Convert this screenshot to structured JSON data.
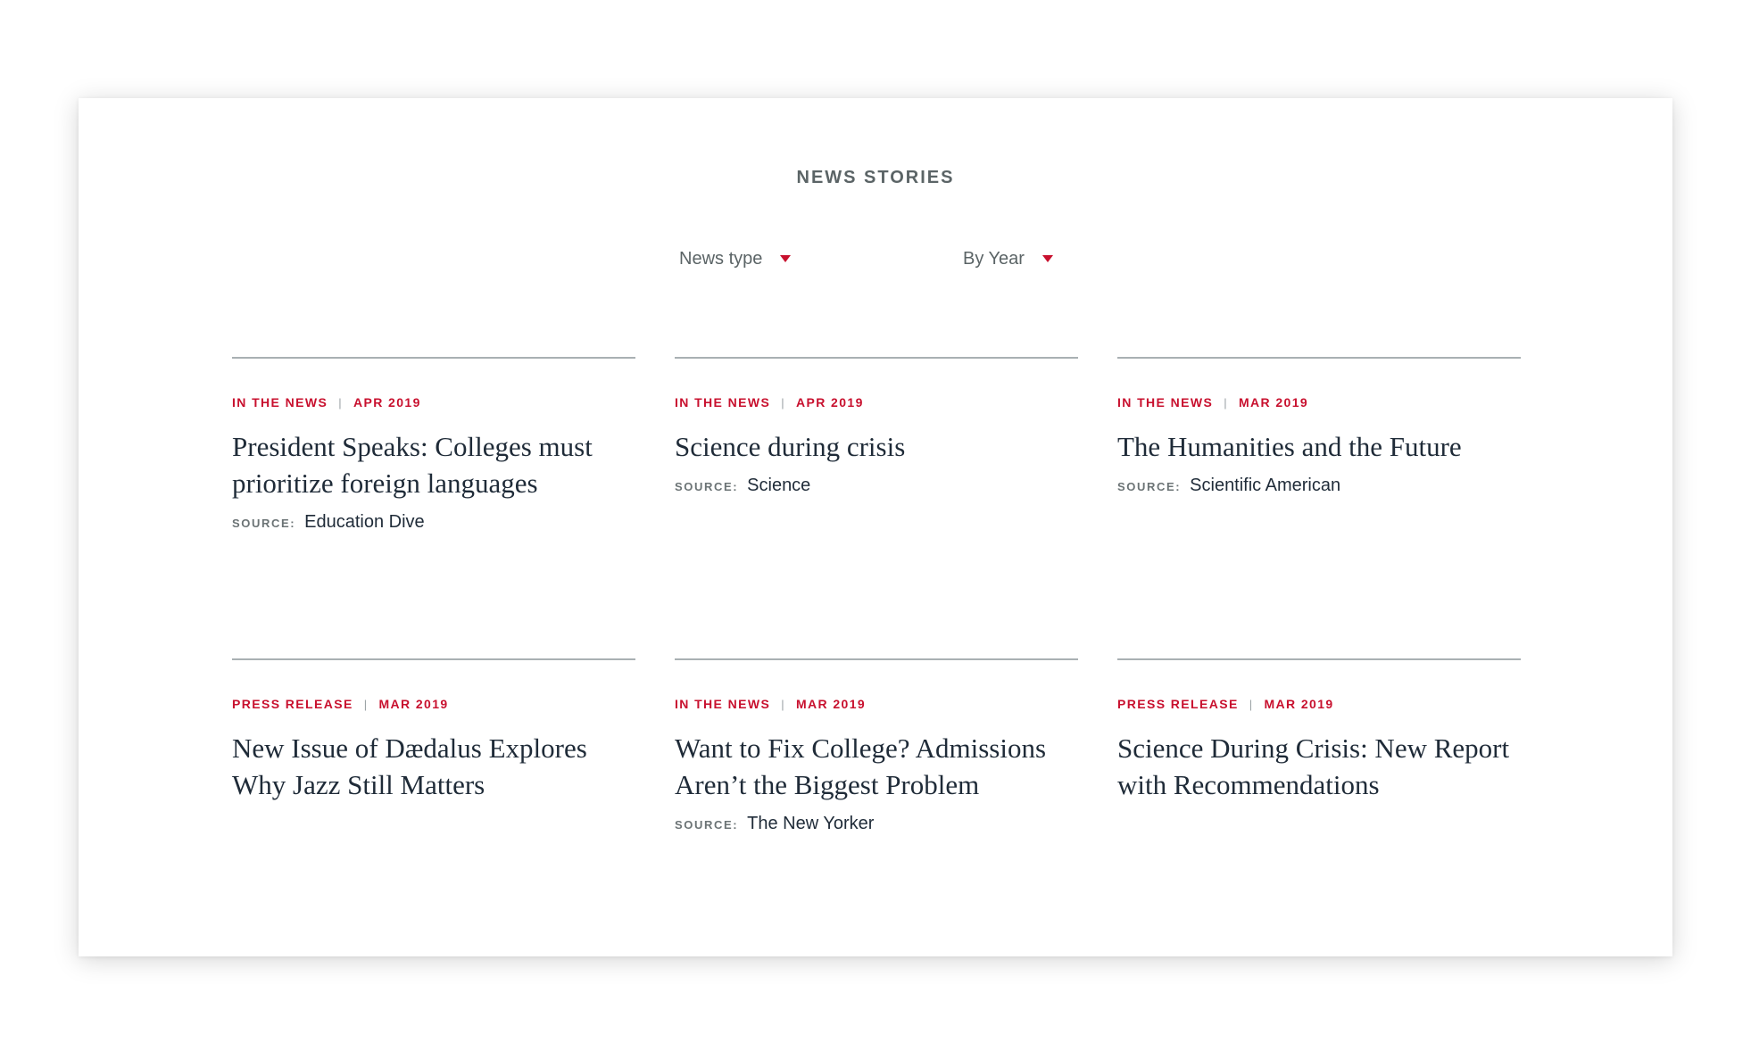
{
  "section": {
    "title": "NEWS STORIES"
  },
  "filters": {
    "news_type": "News type",
    "by_year": "By Year"
  },
  "source_label": "SOURCE:",
  "stories": [
    {
      "type": "IN THE NEWS",
      "date": "APR 2019",
      "title": "President Speaks: Colleges must prioritize foreign languages",
      "source": "Education Dive"
    },
    {
      "type": "IN THE NEWS",
      "date": "APR 2019",
      "title": "Science during crisis",
      "source": "Science"
    },
    {
      "type": "IN THE NEWS",
      "date": "MAR 2019",
      "title": "The Humanities and the Future",
      "source": "Scientific American"
    },
    {
      "type": "PRESS RELEASE",
      "date": "MAR 2019",
      "title": "New Issue of Dædalus Explores Why Jazz Still Matters",
      "source": ""
    },
    {
      "type": "IN THE NEWS",
      "date": "MAR 2019",
      "title": "Want to Fix College? Admissions Aren’t the Biggest Problem",
      "source": "The New Yorker"
    },
    {
      "type": "PRESS RELEASE",
      "date": "MAR 2019",
      "title": "Science During Crisis: New Report with Recommendations",
      "source": ""
    }
  ],
  "colors": {
    "accent": "#c8102e",
    "heading": "#1f2b38",
    "muted": "#5b6466",
    "rule": "#a9b0b3"
  }
}
